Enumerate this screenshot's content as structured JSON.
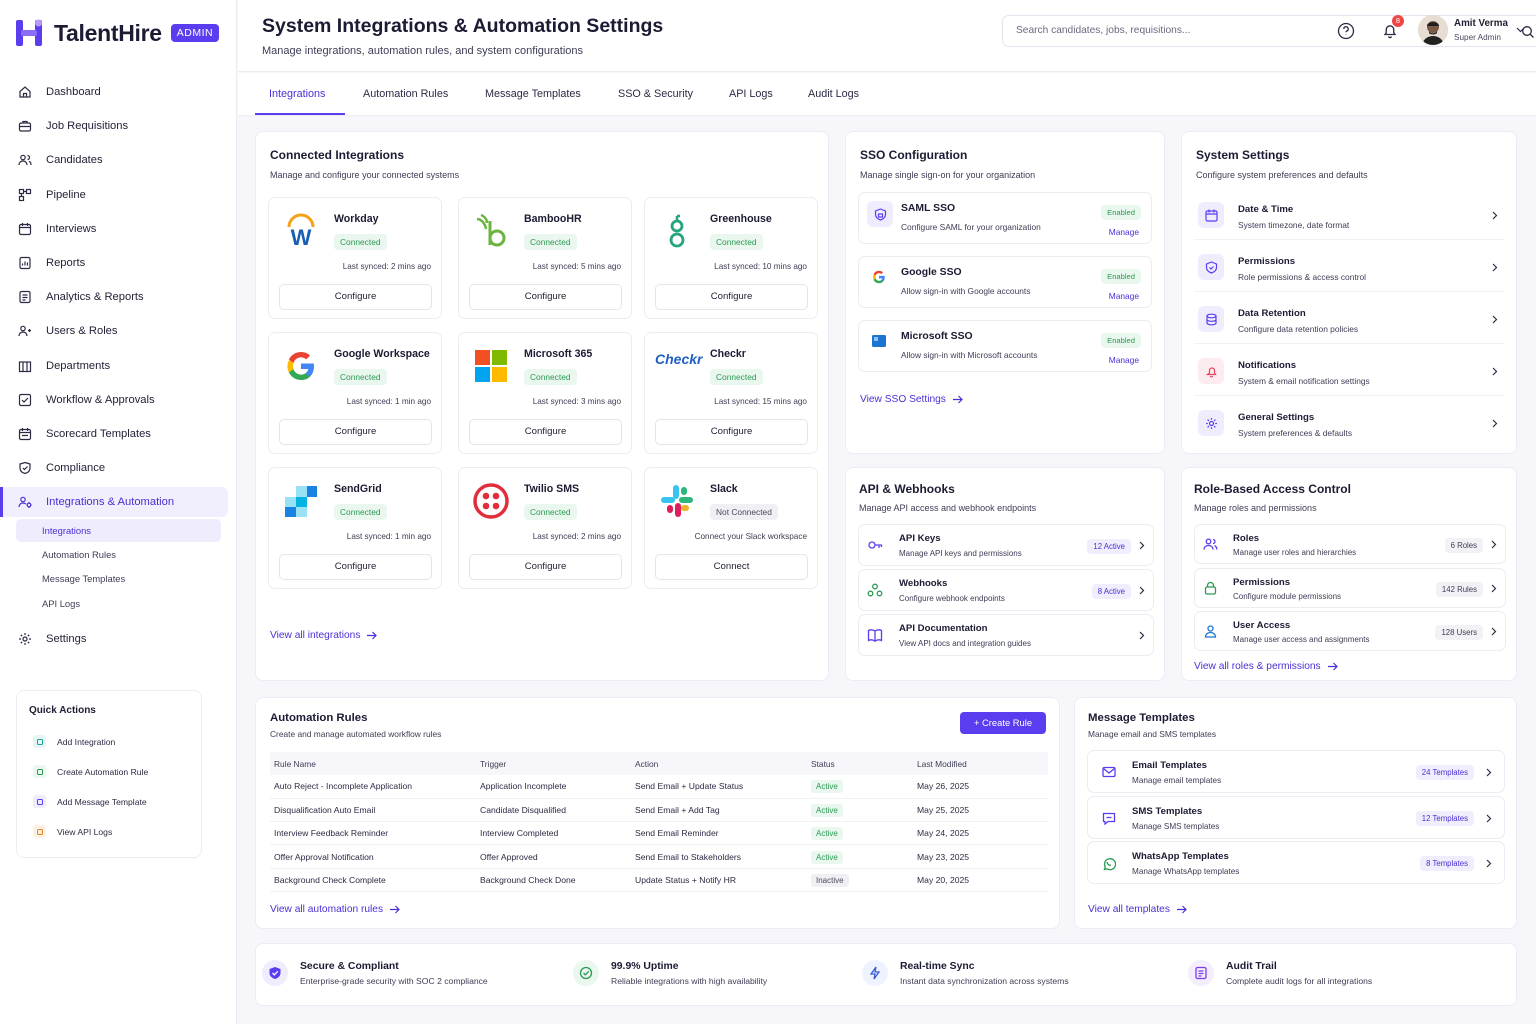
{
  "brand": {
    "name": "TalentHire",
    "badge": "ADMIN",
    "primary": "#5b3df0"
  },
  "nav": [
    {
      "label": "Dashboard",
      "icon": "home-icon"
    },
    {
      "label": "Job Requisitions",
      "icon": "briefcase-icon"
    },
    {
      "label": "Candidates",
      "icon": "users-icon"
    },
    {
      "label": "Pipeline",
      "icon": "pipeline-icon"
    },
    {
      "label": "Interviews",
      "icon": "calendar-icon"
    },
    {
      "label": "Reports",
      "icon": "report-icon"
    },
    {
      "label": "Analytics & Reports",
      "icon": "analytics-icon"
    },
    {
      "label": "Users & Roles",
      "icon": "users-roles-icon"
    },
    {
      "label": "Departments",
      "icon": "building-icon"
    },
    {
      "label": "Workflow & Approvals",
      "icon": "workflow-icon"
    },
    {
      "label": "Scorecard Templates",
      "icon": "scorecard-icon"
    },
    {
      "label": "Compliance",
      "icon": "shield-icon"
    },
    {
      "label": "Integrations & Automation",
      "icon": "integrations-icon"
    }
  ],
  "subnav": [
    "Integrations",
    "Automation Rules",
    "Message Templates",
    "API Logs"
  ],
  "settings_label": "Settings",
  "quick_actions": {
    "title": "Quick Actions",
    "items": [
      "Add Integration",
      "Create Automation Rule",
      "Add Message Template",
      "View API Logs"
    ]
  },
  "header": {
    "title": "System Integrations & Automation Settings",
    "subtitle": "Manage integrations, automation rules, and system configurations",
    "search_placeholder": "Search candidates, jobs, requisitions...",
    "notifications": "8",
    "user_name": "Amit Verma",
    "user_role": "Super Admin"
  },
  "tabs": [
    "Integrations",
    "Automation Rules",
    "Message Templates",
    "SSO & Security",
    "API Logs",
    "Audit Logs"
  ],
  "connected": {
    "title": "Connected Integrations",
    "subtitle": "Manage and configure your connected systems",
    "view_all": "View all integrations",
    "items": [
      {
        "name": "Workday",
        "status": "Connected",
        "sync": "Last synced: 2 mins ago",
        "action": "Configure"
      },
      {
        "name": "BambooHR",
        "status": "Connected",
        "sync": "Last synced: 5 mins ago",
        "action": "Configure"
      },
      {
        "name": "Greenhouse",
        "status": "Connected",
        "sync": "Last synced: 10 mins ago",
        "action": "Configure"
      },
      {
        "name": "Google Workspace",
        "status": "Connected",
        "sync": "Last synced: 1 min ago",
        "action": "Configure"
      },
      {
        "name": "Microsoft 365",
        "status": "Connected",
        "sync": "Last synced: 3 mins ago",
        "action": "Configure"
      },
      {
        "name": "Checkr",
        "status": "Connected",
        "sync": "Last synced: 15 mins ago",
        "action": "Configure",
        "logo_text": "Checkr"
      },
      {
        "name": "SendGrid",
        "status": "Connected",
        "sync": "Last synced: 1 min ago",
        "action": "Configure"
      },
      {
        "name": "Twilio SMS",
        "status": "Connected",
        "sync": "Last synced: 2 mins ago",
        "action": "Configure"
      },
      {
        "name": "Slack",
        "status": "Not Connected",
        "sync": "Connect your Slack workspace",
        "action": "Connect"
      }
    ]
  },
  "sso": {
    "title": "SSO Configuration",
    "subtitle": "Manage single sign-on for your organization",
    "view_all": "View SSO Settings",
    "items": [
      {
        "name": "SAML SSO",
        "desc": "Configure SAML for your organization",
        "status": "Enabled",
        "action": "Manage"
      },
      {
        "name": "Google SSO",
        "desc": "Allow sign-in with Google accounts",
        "status": "Enabled",
        "action": "Manage"
      },
      {
        "name": "Microsoft SSO",
        "desc": "Allow sign-in with Microsoft accounts",
        "status": "Enabled",
        "action": "Manage"
      }
    ]
  },
  "system": {
    "title": "System Settings",
    "subtitle": "Configure system preferences and defaults",
    "items": [
      {
        "name": "Date & Time",
        "desc": "System timezone, date format"
      },
      {
        "name": "Permissions",
        "desc": "Role permissions & access control"
      },
      {
        "name": "Data Retention",
        "desc": "Configure data retention policies"
      },
      {
        "name": "Notifications",
        "desc": "System & email notification settings"
      },
      {
        "name": "General Settings",
        "desc": "System preferences & defaults"
      }
    ]
  },
  "api": {
    "title": "API & Webhooks",
    "subtitle": "Manage API access and webhook endpoints",
    "items": [
      {
        "name": "API Keys",
        "desc": "Manage API keys and permissions",
        "count": "12 Active"
      },
      {
        "name": "Webhooks",
        "desc": "Configure webhook endpoints",
        "count": "8 Active"
      },
      {
        "name": "API Documentation",
        "desc": "View API docs and integration guides",
        "count": ""
      }
    ]
  },
  "rbac": {
    "title": "Role-Based Access Control",
    "subtitle": "Manage roles and permissions",
    "view_all": "View all roles & permissions",
    "items": [
      {
        "name": "Roles",
        "desc": "Manage user roles and hierarchies",
        "count": "6 Roles"
      },
      {
        "name": "Permissions",
        "desc": "Configure module permissions",
        "count": "142 Rules"
      },
      {
        "name": "User Access",
        "desc": "Manage user access and assignments",
        "count": "128 Users"
      }
    ]
  },
  "automation": {
    "title": "Automation Rules",
    "subtitle": "Create and manage automated workflow rules",
    "create": "Create Rule",
    "view_all": "View all automation rules",
    "columns": [
      "Rule Name",
      "Trigger",
      "Action",
      "Status",
      "Last Modified"
    ],
    "rows": [
      [
        "Auto Reject - Incomplete Application",
        "Application Incomplete",
        "Send Email + Update Status",
        "Active",
        "May 26, 2025"
      ],
      [
        "Disqualification Auto Email",
        "Candidate Disqualified",
        "Send Email + Add Tag",
        "Active",
        "May 25, 2025"
      ],
      [
        "Interview Feedback Reminder",
        "Interview Completed",
        "Send Email Reminder",
        "Active",
        "May 24, 2025"
      ],
      [
        "Offer Approval Notification",
        "Offer Approved",
        "Send Email to Stakeholders",
        "Active",
        "May 23, 2025"
      ],
      [
        "Background Check Complete",
        "Background Check Done",
        "Update Status + Notify HR",
        "Inactive",
        "May 20, 2025"
      ]
    ]
  },
  "messages": {
    "title": "Message Templates",
    "subtitle": "Manage email and SMS templates",
    "view_all": "View all templates",
    "items": [
      {
        "name": "Email Templates",
        "desc": "Manage email templates",
        "count": "24 Templates"
      },
      {
        "name": "SMS Templates",
        "desc": "Manage SMS templates",
        "count": "12 Templates"
      },
      {
        "name": "WhatsApp Templates",
        "desc": "Manage WhatsApp templates",
        "count": "8 Templates"
      }
    ]
  },
  "features": [
    {
      "title": "Secure & Compliant",
      "desc": "Enterprise-grade security with SOC 2 compliance"
    },
    {
      "title": "99.9% Uptime",
      "desc": "Reliable integrations with high availability"
    },
    {
      "title": "Real-time Sync",
      "desc": "Instant data synchronization across systems"
    },
    {
      "title": "Audit Trail",
      "desc": "Complete audit logs for all integrations"
    }
  ]
}
